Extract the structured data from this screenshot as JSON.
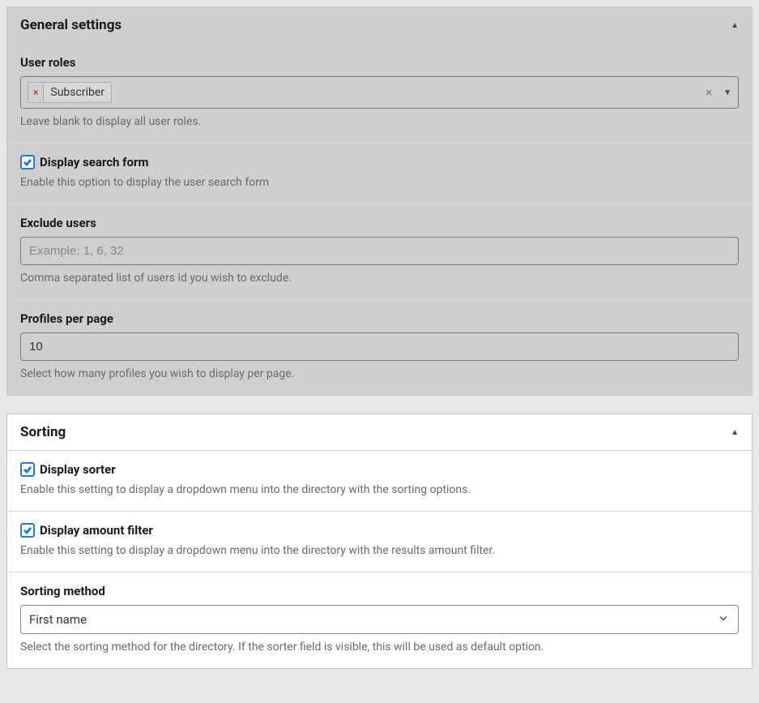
{
  "general": {
    "title": "General settings",
    "user_roles": {
      "label": "User roles",
      "tags": [
        "Subscriber"
      ],
      "help": "Leave blank to display all user roles."
    },
    "display_search": {
      "checked": true,
      "label": "Display search form",
      "help": "Enable this option to display the user search form"
    },
    "exclude_users": {
      "label": "Exclude users",
      "placeholder": "Example: 1, 6, 32",
      "value": "",
      "help": "Comma separated list of users id you wish to exclude."
    },
    "profiles_per_page": {
      "label": "Profiles per page",
      "value": "10",
      "help": "Select how many profiles you wish to display per page."
    }
  },
  "sorting": {
    "title": "Sorting",
    "display_sorter": {
      "checked": true,
      "label": "Display sorter",
      "help": "Enable this setting to display a dropdown menu into the directory with the sorting options."
    },
    "display_amount_filter": {
      "checked": true,
      "label": "Display amount filter",
      "help": "Enable this setting to display a dropdown menu into the directory with the results amount filter."
    },
    "sorting_method": {
      "label": "Sorting method",
      "value": "First name",
      "help": "Select the sorting method for the directory. If the sorter field is visible, this will be used as default option."
    }
  }
}
